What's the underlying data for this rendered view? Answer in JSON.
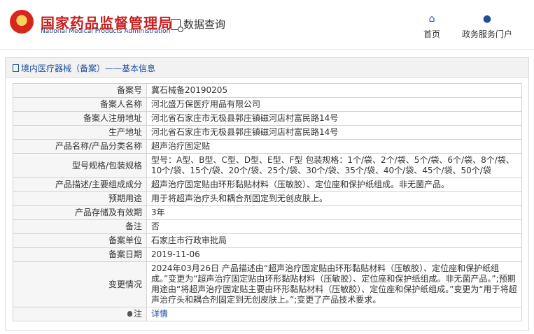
{
  "header": {
    "logo_cn": "国家药品监督管理局",
    "logo_en": "National Medical Products Administration",
    "query_label": "数据查询",
    "nav": [
      {
        "label": "首页",
        "icon": "home-icon"
      },
      {
        "label": "政务服务门户",
        "icon": "user-icon"
      }
    ]
  },
  "panel": {
    "title": "境内医疗器械（备案）——基本信息"
  },
  "rows": [
    {
      "key": "备案号",
      "value": "冀石械备20190205"
    },
    {
      "key": "备案人名称",
      "value": "河北盛万保医疗用品有限公司"
    },
    {
      "key": "备案人注册地址",
      "value": "河北省石家庄市无极县郭庄镇磁河店村富民路14号"
    },
    {
      "key": "生产地址",
      "value": "河北省石家庄市无极县郭庄镇磁河店村富民路14号"
    },
    {
      "key": "产品名称/产品分类名称",
      "value": "超声治疗固定贴"
    },
    {
      "key": "型号规格/包装规格",
      "value": "型号：A型、B型、C型、D型、E型、F型 包装规格：1个/袋、2个/袋、5个/袋、6个/袋、8个/袋、10个/袋、15个/袋、20个/袋、25个/袋、30个/袋、35个/袋、40个/袋、45个/袋、50个/袋"
    },
    {
      "key": "产品描述/主要组成成分",
      "value": "超声治疗固定贴由环形黏贴材料（压敏胶）、定位座和保护纸组成。非无菌产品。"
    },
    {
      "key": "预期用途",
      "value": "用于将超声治疗头和耦合剂固定到无创皮肤上。"
    },
    {
      "key": "产品存储及有效期",
      "value": "3年"
    },
    {
      "key": "备注",
      "value": "否"
    },
    {
      "key": "备案单位",
      "value": "石家庄市行政审批局"
    },
    {
      "key": "备案日期",
      "value": "2019-11-06"
    },
    {
      "key": "变更情况",
      "value": "2024年03月26日 产品描述由“超声治疗固定贴由环形黏贴材料（压敏胶）、定位座和保护纸组成。”变更为“超声治疗固定贴由环形黏贴材料（压敏胶）、定位座和保护纸组成。非无菌产品。”;预期用途由“将超声治疗固定贴主要由环形黏贴材料（压敏胶）、定位座和保护纸组成。”变更为“用于将超声治疗头和耦合剂固定到无创皮肤上。”;变更了产品技术要求。"
    },
    {
      "key": "注",
      "value": "详情",
      "icon": "lightbulb-icon"
    }
  ],
  "colors": {
    "accent": "#1d4e9a",
    "brand": "#c81e1e"
  }
}
